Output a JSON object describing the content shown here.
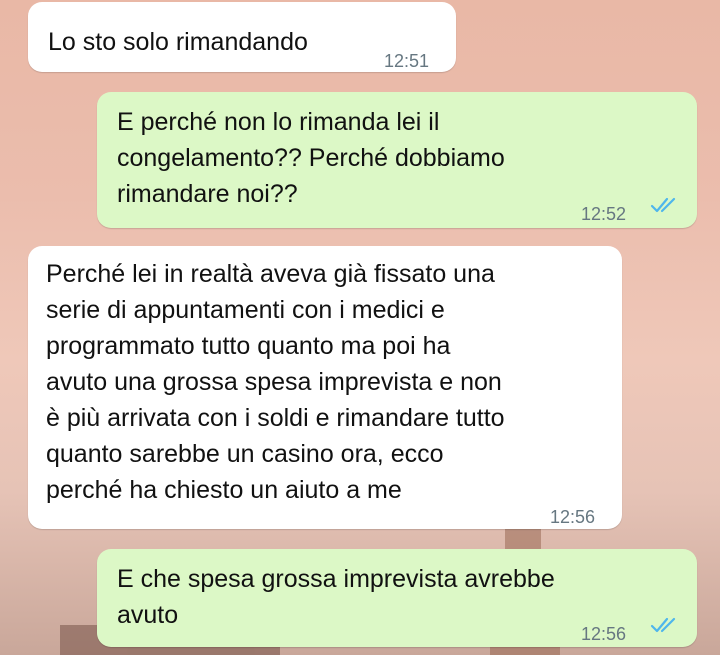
{
  "chat": {
    "messages": [
      {
        "direction": "incoming",
        "text": "Lo sto solo rimandando",
        "time": "12:51"
      },
      {
        "direction": "outgoing",
        "text": "E perché non lo rimanda lei il\ncongelamento?? Perché dobbiamo\nrimandare noi??",
        "time": "12:52",
        "status": "read"
      },
      {
        "direction": "incoming",
        "text": "Perché lei in realtà aveva già fissato una\nserie di appuntamenti con i medici e\nprogrammato tutto quanto ma poi ha\navuto una grossa spesa imprevista e non\nè più arrivata con i soldi e rimandare tutto\nquanto sarebbe un casino ora, ecco\nperché ha chiesto un aiuto a me",
        "time": "12:56"
      },
      {
        "direction": "outgoing",
        "text": "E che spesa grossa imprevista avrebbe\navuto",
        "time": "12:56",
        "status": "read"
      }
    ]
  },
  "colors": {
    "incoming_bubble": "#ffffff",
    "outgoing_bubble": "#dcf8c6",
    "read_ticks": "#4fb6ec",
    "timestamp": "#667781"
  },
  "icons": {
    "read_receipt": "double-check-icon"
  }
}
